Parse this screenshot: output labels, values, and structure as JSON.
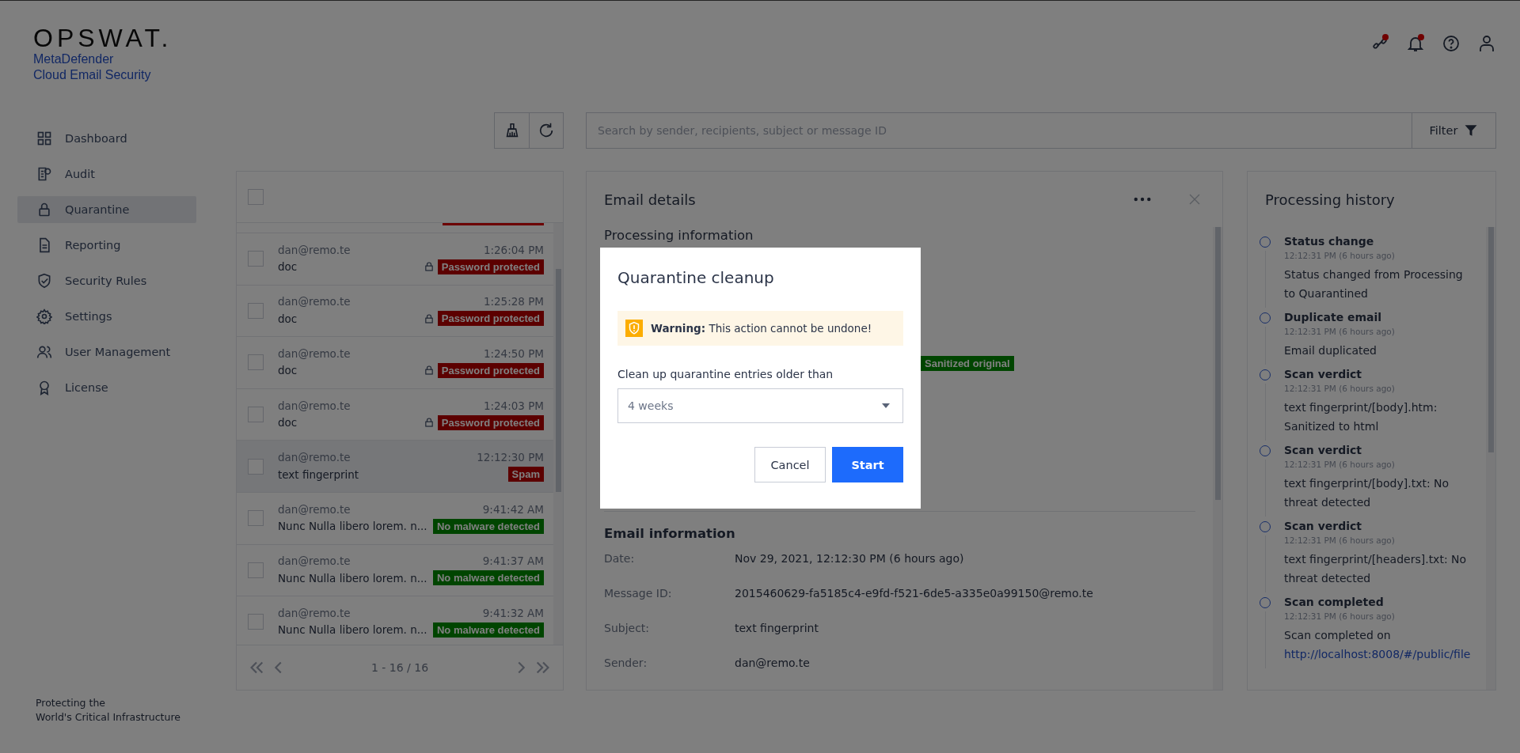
{
  "brand": {
    "logo": "OPSWAT.",
    "product": [
      "MetaDefender",
      "Cloud Email Security"
    ]
  },
  "header_icons": [
    {
      "kind": "link",
      "alert": true
    },
    {
      "kind": "bell",
      "alert": true
    },
    {
      "kind": "help",
      "alert": false
    },
    {
      "kind": "user",
      "alert": false
    }
  ],
  "sidebar": {
    "items": [
      {
        "label": "Dashboard",
        "selected": false
      },
      {
        "label": "Audit",
        "selected": false
      },
      {
        "label": "Quarantine",
        "selected": true
      },
      {
        "label": "Reporting",
        "selected": false
      },
      {
        "label": "Security Rules",
        "selected": false
      },
      {
        "label": "Settings",
        "selected": false
      },
      {
        "label": "User Management",
        "selected": false
      },
      {
        "label": "License",
        "selected": false
      }
    ],
    "footer": [
      "Protecting the",
      "World's Critical Infrastructure"
    ]
  },
  "search": {
    "placeholder": "Search by sender, recipients, subject or message ID",
    "filter": "Filter"
  },
  "list": {
    "select_all": {
      "checked": false
    },
    "rows": [
      {
        "sender": "dan@remo.te",
        "time": "1:26:04 PM",
        "subject": "doc",
        "locked": true,
        "verdict": "Password protected",
        "kind": "danger",
        "selected": false,
        "checked": false
      },
      {
        "sender": "dan@remo.te",
        "time": "1:25:28 PM",
        "subject": "doc",
        "locked": true,
        "verdict": "Password protected",
        "kind": "danger",
        "selected": false,
        "checked": false
      },
      {
        "sender": "dan@remo.te",
        "time": "1:24:50 PM",
        "subject": "doc",
        "locked": true,
        "verdict": "Password protected",
        "kind": "danger",
        "selected": false,
        "checked": false
      },
      {
        "sender": "dan@remo.te",
        "time": "1:24:03 PM",
        "subject": "doc",
        "locked": true,
        "verdict": "Password protected",
        "kind": "danger",
        "selected": false,
        "checked": false
      },
      {
        "sender": "dan@remo.te",
        "time": "12:12:30 PM",
        "subject": "text fingerprint",
        "locked": false,
        "verdict": "Spam",
        "kind": "danger",
        "selected": true,
        "checked": false
      },
      {
        "sender": "dan@remo.te",
        "time": "9:41:42 AM",
        "subject": "Nunc Nulla libero lorem. n...",
        "locked": false,
        "verdict": "No malware detected",
        "kind": "success",
        "selected": false,
        "checked": false
      },
      {
        "sender": "dan@remo.te",
        "time": "9:41:37 AM",
        "subject": "Nunc Nulla libero lorem. n...",
        "locked": false,
        "verdict": "No malware detected",
        "kind": "success",
        "selected": false,
        "checked": false
      },
      {
        "sender": "dan@remo.te",
        "time": "9:41:32 AM",
        "subject": "Nunc Nulla libero lorem. n...",
        "locked": false,
        "verdict": "No malware detected",
        "kind": "success",
        "selected": false,
        "checked": false
      }
    ],
    "pagination": "1 - 16 / 16"
  },
  "details": {
    "title": "Email details",
    "processing_title": "Processing information",
    "badge": "Sanitized original",
    "email_title": "Email information",
    "fields": [
      {
        "label": "Date:",
        "value": "Nov 29, 2021, 12:12:30 PM (6 hours ago)"
      },
      {
        "label": "Message ID:",
        "value": "2015460629-fa5185c4-e9fd-f521-6de5-a335e0a99150@remo.te"
      },
      {
        "label": "Subject:",
        "value": "text fingerprint"
      },
      {
        "label": "Sender:",
        "value": "dan@remo.te"
      }
    ]
  },
  "history": {
    "title": "Processing history",
    "items": [
      {
        "title": "Status change",
        "time": "12:12:31 PM (6 hours ago)",
        "text": "Status changed from Processing to Quarantined"
      },
      {
        "title": "Duplicate email",
        "time": "12:12:31 PM (6 hours ago)",
        "text": "Email duplicated"
      },
      {
        "title": "Scan verdict",
        "time": "12:12:31 PM (6 hours ago)",
        "text": "text fingerprint/[body].htm: Sanitized to html"
      },
      {
        "title": "Scan verdict",
        "time": "12:12:31 PM (6 hours ago)",
        "text": "text fingerprint/[body].txt: No threat detected"
      },
      {
        "title": "Scan verdict",
        "time": "12:12:31 PM (6 hours ago)",
        "text": "text fingerprint/[headers].txt: No threat detected"
      },
      {
        "title": "Scan completed",
        "time": "12:12:31 PM (6 hours ago)",
        "text": "Scan completed on",
        "link": "http://localhost:8008/#/public/file"
      }
    ]
  },
  "modal": {
    "title": "Quarantine cleanup",
    "warning": "**Warning:** This action cannot be undone!",
    "label": "Clean up quarantine entries older than",
    "value": "4 weeks",
    "buttons": [
      {
        "label": "Cancel",
        "kind": "secondary"
      },
      {
        "label": "Start",
        "kind": "primary"
      }
    ]
  }
}
